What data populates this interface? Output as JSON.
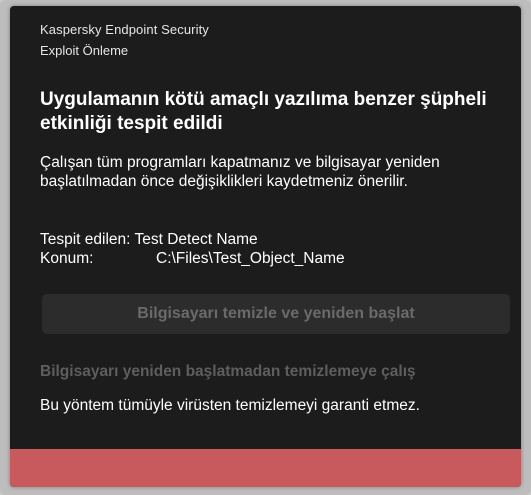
{
  "notification": {
    "app_name": "Kaspersky Endpoint Security",
    "component": "Exploit Önleme",
    "headline": "Uygulamanın kötü amaçlı yazılıma benzer şüpheli etkinliği tespit edildi",
    "description": "Çalışan tüm programları kapatmanız ve bilgisayar yeniden başlatılmadan önce değişiklikleri kaydetmeniz önerilir.",
    "detected_label": "Tespit edilen:",
    "detected_value": "Test Detect Name",
    "location_label": "Konum:",
    "location_value": "C:\\Files\\Test_Object_Name",
    "primary_button_label": "Bilgisayarı temizle ve yeniden başlat",
    "secondary_link_label": "Bilgisayarı yeniden başlatmadan temizlemeye çalış",
    "warning_text": "Bu yöntem tümüyle virüsten temizlemeyi garanti etmez."
  },
  "colors": {
    "background": "#1c1c1c",
    "text": "#ffffff",
    "disabled_text": "#6a6a6a",
    "accent": "#c85a5e"
  }
}
